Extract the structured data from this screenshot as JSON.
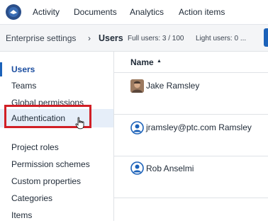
{
  "nav": {
    "items": [
      "Activity",
      "Documents",
      "Analytics",
      "Action items"
    ]
  },
  "breadcrumb": {
    "parent": "Enterprise settings",
    "separator": "›",
    "current": "Users",
    "full_users": "Full users: 3 / 100",
    "light_users": "Light users: 0 ..."
  },
  "sidebar": {
    "items": [
      {
        "label": "Users"
      },
      {
        "label": "Teams"
      },
      {
        "label": "Global permissions"
      },
      {
        "label": "Authentication"
      },
      {
        "label": "Project roles"
      },
      {
        "label": "Permission schemes"
      },
      {
        "label": "Custom properties"
      },
      {
        "label": "Categories"
      },
      {
        "label": "Items"
      }
    ]
  },
  "table": {
    "column_name": "Name",
    "sort_indicator": "▲",
    "rows": [
      {
        "name": "Jake Ramsley",
        "avatar": "photo"
      },
      {
        "name": "jramsley@ptc.com Ramsley",
        "avatar": "generic-user-icon"
      },
      {
        "name": "Rob Anselmi",
        "avatar": "generic-user-icon"
      }
    ]
  },
  "colors": {
    "accent": "#1c62b9",
    "highlight_box": "#d11f26",
    "hover_row": "#e6eef9"
  }
}
